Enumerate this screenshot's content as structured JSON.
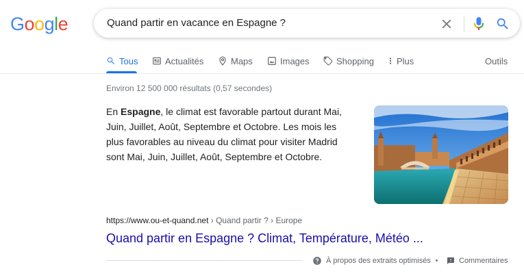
{
  "logo": {
    "letters": [
      "G",
      "o",
      "o",
      "g",
      "l",
      "e"
    ],
    "colors": [
      "#4285F4",
      "#EA4335",
      "#FBBC05",
      "#4285F4",
      "#34A853",
      "#EA4335"
    ]
  },
  "search": {
    "query": "Quand partir en vacance en Espagne ?",
    "clear_icon": "close-icon",
    "mic_icon": "microphone-icon",
    "search_icon": "search-icon"
  },
  "tabs": [
    {
      "label": "Tous",
      "icon": "search-icon",
      "active": true
    },
    {
      "label": "Actualités",
      "icon": "newspaper-icon",
      "active": false
    },
    {
      "label": "Maps",
      "icon": "map-pin-icon",
      "active": false
    },
    {
      "label": "Images",
      "icon": "image-icon",
      "active": false
    },
    {
      "label": "Shopping",
      "icon": "tag-icon",
      "active": false
    },
    {
      "label": "Plus",
      "icon": "more-vert-icon",
      "active": false
    }
  ],
  "tools_label": "Outils",
  "result_stats": "Environ 12 500 000 résultats (0,57 secondes)",
  "featured_snippet": {
    "prefix": "En ",
    "bold": "Espagne",
    "text": ", le climat est favorable partout durant Mai, Juin, Juillet, Août, Septembre et Octobre. Les mois les plus favorables au niveau du climat pour visiter Madrid sont Mai, Juin, Juillet, Août, Septembre et Octobre.",
    "image_subject": "plaza-de-espana-seville"
  },
  "result": {
    "cite_domain": "https://www.ou-et-quand.net",
    "cite_path": " › Quand partir ? › Europe",
    "title": "Quand partir en Espagne ? Climat, Température, Météo ..."
  },
  "footer": {
    "about_label": "À propos des extraits optimisés",
    "feedback_label": "Commentaires"
  },
  "colors": {
    "accent": "#1a73e8",
    "link": "#1a0dab"
  }
}
